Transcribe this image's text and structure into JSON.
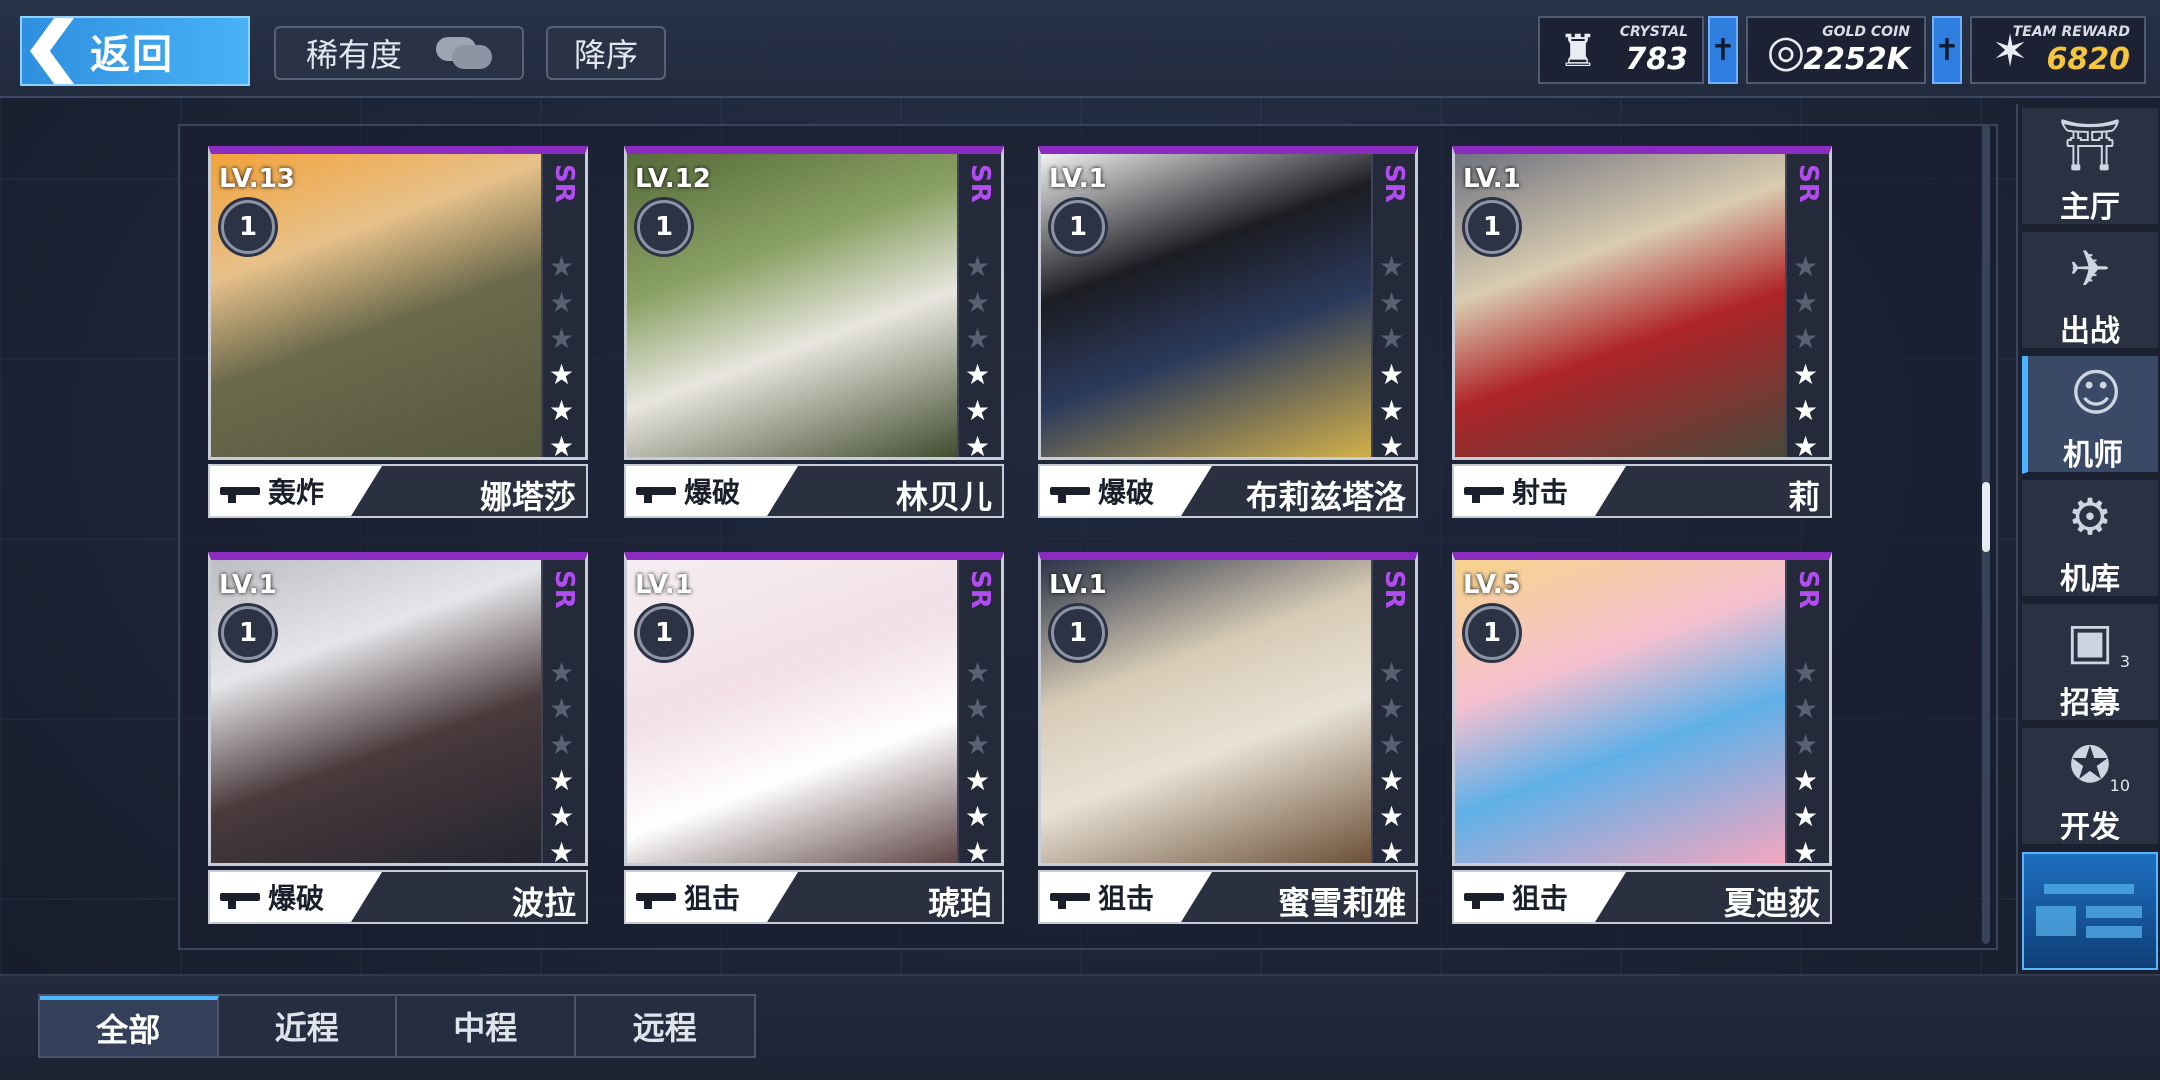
{
  "header": {
    "back_label": "返回",
    "filter_label": "稀有度",
    "sort_label": "降序",
    "resources": [
      {
        "label": "CRYSTAL",
        "value": "783",
        "icon": "crystal-icon"
      },
      {
        "label": "GOLD COIN",
        "value": "2252K",
        "icon": "gold-coin-icon"
      },
      {
        "label": "TEAM REWARD",
        "value": "6820",
        "icon": "team-reward-icon"
      }
    ],
    "plus_label": "✝"
  },
  "cards": [
    {
      "level": "LV.13",
      "badge": "1",
      "rarity": "SR",
      "stars": 3,
      "max_stars": 6,
      "role": "轰炸",
      "name": "娜塔莎"
    },
    {
      "level": "LV.12",
      "badge": "1",
      "rarity": "SR",
      "stars": 3,
      "max_stars": 6,
      "role": "爆破",
      "name": "林贝儿"
    },
    {
      "level": "LV.1",
      "badge": "1",
      "rarity": "SR",
      "stars": 3,
      "max_stars": 6,
      "role": "爆破",
      "name": "布莉兹塔洛"
    },
    {
      "level": "LV.1",
      "badge": "1",
      "rarity": "SR",
      "stars": 3,
      "max_stars": 6,
      "role": "射击",
      "name": "莉"
    },
    {
      "level": "LV.1",
      "badge": "1",
      "rarity": "SR",
      "stars": 3,
      "max_stars": 6,
      "role": "爆破",
      "name": "波拉"
    },
    {
      "level": "LV.1",
      "badge": "1",
      "rarity": "SR",
      "stars": 3,
      "max_stars": 6,
      "role": "狙击",
      "name": "琥珀"
    },
    {
      "level": "LV.1",
      "badge": "1",
      "rarity": "SR",
      "stars": 3,
      "max_stars": 6,
      "role": "狙击",
      "name": "蜜雪莉雅"
    },
    {
      "level": "LV.5",
      "badge": "1",
      "rarity": "SR",
      "stars": 3,
      "max_stars": 6,
      "role": "狙击",
      "name": "夏迪荻"
    }
  ],
  "nav": [
    {
      "label": "主厅",
      "icon": "hall-icon",
      "active": false,
      "count": ""
    },
    {
      "label": "出战",
      "icon": "battle-icon",
      "active": false,
      "count": ""
    },
    {
      "label": "机师",
      "icon": "pilot-icon",
      "active": true,
      "count": ""
    },
    {
      "label": "机库",
      "icon": "hangar-icon",
      "active": false,
      "count": ""
    },
    {
      "label": "招募",
      "icon": "recruit-icon",
      "active": false,
      "count": "3"
    },
    {
      "label": "开发",
      "icon": "develop-icon",
      "active": false,
      "count": "10"
    }
  ],
  "tabs": [
    {
      "label": "全部",
      "active": true
    },
    {
      "label": "近程",
      "active": false
    },
    {
      "label": "中程",
      "active": false
    },
    {
      "label": "远程",
      "active": false
    }
  ],
  "colors": {
    "accent": "#49b4ff",
    "rarity": "#b34cf0",
    "card_top": "#8a2cc0"
  }
}
